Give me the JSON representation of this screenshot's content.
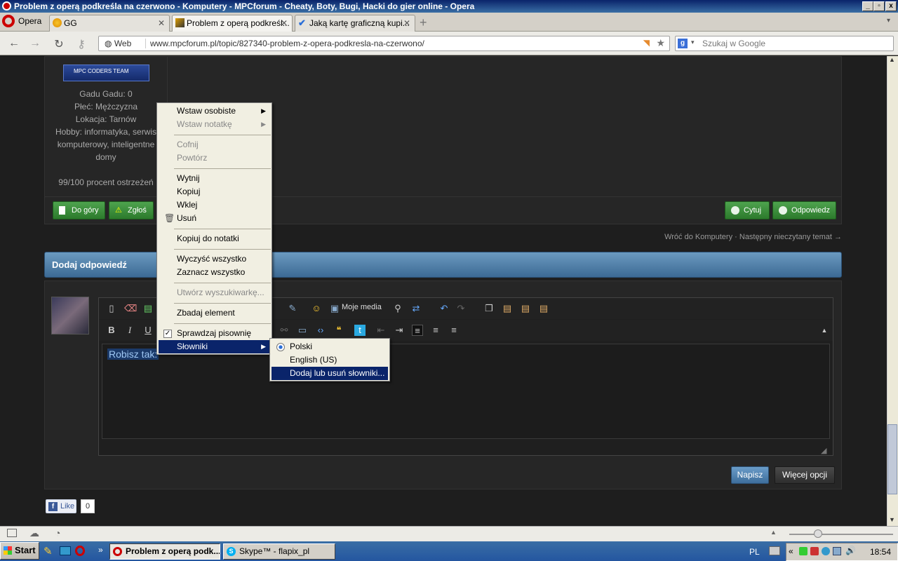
{
  "window": {
    "title": "Problem z operą podkreśla na czerwono - Komputery - MPCforum - Cheaty, Boty, Bugi, Hacki do gier online - Opera",
    "min": "_",
    "max": "▫",
    "close": "x"
  },
  "browser": {
    "opera_label": "Opera",
    "tabs": [
      {
        "label": "GG"
      },
      {
        "label": "Problem z operą podkreśl..."
      },
      {
        "label": "Jaką kartę graficzną kupi..."
      }
    ],
    "web_label": "Web",
    "url": "www.mpcforum.pl/topic/827340-problem-z-opera-podkresla-na-czerwono/",
    "search_placeholder": "Szukaj w Google",
    "search_engine_icon": "g"
  },
  "post": {
    "banner_text": "MPC CODERS TEAM",
    "profile_lines": [
      "Gadu Gadu: 0",
      "Płeć: Mężczyzna",
      "Lokacja: Tarnów",
      "Hobby: informatyka, serwis",
      "komputerowy, inteligentne",
      "domy",
      "99/100 procent ostrzeżeń"
    ],
    "btn_top": "Do góry",
    "btn_report": "Zgłoś",
    "btn_quote": "Cytuj",
    "btn_reply": "Odpowiedz"
  },
  "nav": {
    "back_link": "Wróć do Komputery",
    "dot": "·",
    "next_link": "Następny nieczytany temat →"
  },
  "reply": {
    "header": "Dodaj odpowiedź",
    "my_media": "Moje media",
    "typed_text": "Robisz tak:",
    "submit": "Napisz",
    "more_options": "Więcej opcji"
  },
  "facebook": {
    "like": "Like",
    "count": "0"
  },
  "context_menu": {
    "items": [
      {
        "label": "Wstaw osobiste",
        "submenu": true
      },
      {
        "label": "Wstaw notatkę",
        "submenu": true,
        "disabled": true
      },
      {
        "label": "Cofnij",
        "disabled": true
      },
      {
        "label": "Powtórz",
        "disabled": true
      },
      {
        "label": "Wytnij"
      },
      {
        "label": "Kopiuj"
      },
      {
        "label": "Wklej"
      },
      {
        "label": "Usuń"
      },
      {
        "label": "Kopiuj do notatki"
      },
      {
        "label": "Wyczyść wszystko"
      },
      {
        "label": "Zaznacz wszystko"
      },
      {
        "label": "Utwórz wyszukiwarkę...",
        "disabled": true
      },
      {
        "label": "Zbadaj element"
      },
      {
        "label": "Sprawdzaj pisownię",
        "checked": true
      },
      {
        "label": "Słowniki",
        "submenu": true,
        "selected": true
      }
    ],
    "submenu_items": [
      {
        "label": "Polski",
        "radio": true
      },
      {
        "label": "English (US)"
      },
      {
        "label": "Dodaj lub usuń słowniki...",
        "selected": true
      }
    ]
  },
  "taskbar": {
    "start": "Start",
    "items": [
      "Problem z operą podk...",
      "Skype™ - flapix_pl"
    ],
    "lang": "PL",
    "clock": "18:54"
  },
  "colors": {
    "accent": "#0a246a",
    "green_btn": "#3a8f3a",
    "header_blue": "#4f80ad"
  }
}
